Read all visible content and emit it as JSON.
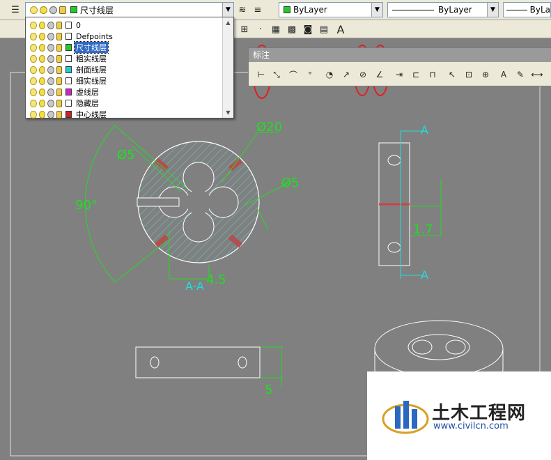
{
  "layer_toolbar": {
    "current_layer": "尺寸线层",
    "color_combo": "ByLayer",
    "linetype_combo": "ByLayer",
    "lineweight_combo": "ByLa"
  },
  "layers": [
    {
      "name": "0",
      "color": "#ffffff"
    },
    {
      "name": "Defpoints",
      "color": "#ffffff"
    },
    {
      "name": "尺寸线层",
      "color": "#22cc22",
      "selected": true
    },
    {
      "name": "粗实线层",
      "color": "#ffffff"
    },
    {
      "name": "剖面线层",
      "color": "#22cccc"
    },
    {
      "name": "细实线层",
      "color": "#ffffff"
    },
    {
      "name": "虚线层",
      "color": "#cc22cc"
    },
    {
      "name": "隐藏层",
      "color": "#ffffff"
    },
    {
      "name": "中心线层",
      "color": "#cc2222"
    }
  ],
  "dim_panel": {
    "title": "标注"
  },
  "drawing": {
    "dims": {
      "d20": "Ø20",
      "d5a": "Ø5",
      "d5b": "Ø5",
      "angle": "90°",
      "len45": "4.5",
      "len5": "5",
      "len17": "1.7",
      "len5b": "5",
      "section": "A-A",
      "markA1": "A",
      "markA2": "A"
    }
  },
  "watermark": {
    "main": "土木工程网",
    "url": "www.civilcn.com"
  }
}
